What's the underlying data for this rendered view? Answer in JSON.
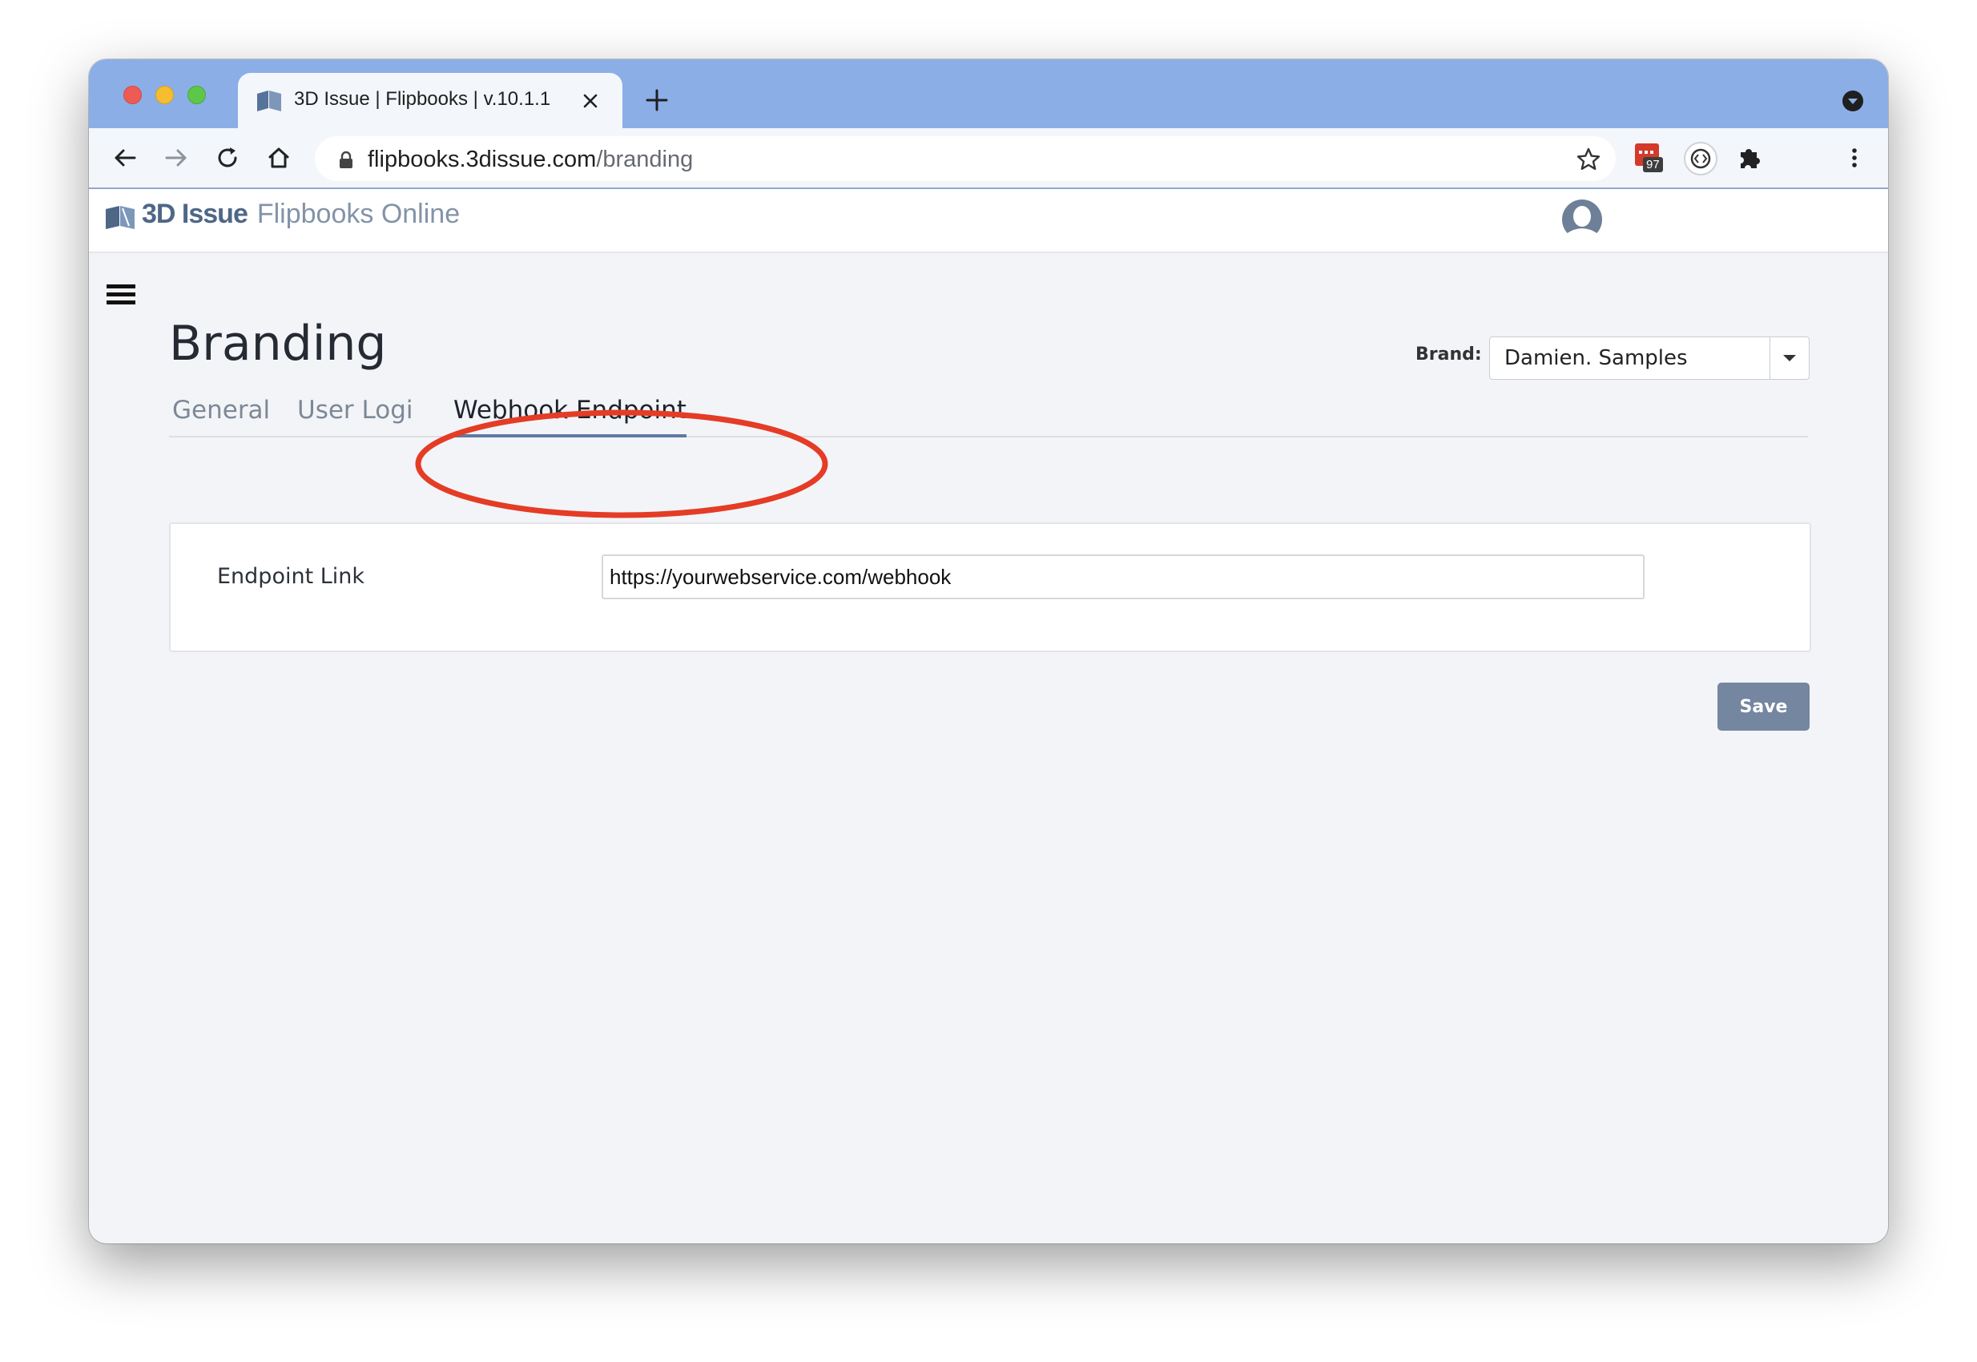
{
  "browser": {
    "tab_title": "3D Issue | Flipbooks | v.10.1.1",
    "url_host": "flipbooks.3dissue.com",
    "url_path": "/branding",
    "extension_badge": "97"
  },
  "header": {
    "logo_strong": "3D Issue",
    "logo_light": "Flipbooks Online"
  },
  "page": {
    "title": "Branding",
    "brand_label": "Brand:",
    "brand_value": "Damien. Samples",
    "tabs": [
      {
        "label": "General"
      },
      {
        "label": "User Login"
      },
      {
        "label": "Webhook Endpoint",
        "active": true
      }
    ]
  },
  "form": {
    "endpoint_label": "Endpoint Link",
    "endpoint_value": "https://yourwebservice.com/webhook"
  },
  "actions": {
    "save_label": "Save"
  },
  "colors": {
    "tabstrip": "#8caee6",
    "accent": "#5f7aa2",
    "save_button": "#7486a0",
    "annotation": "#e43c25"
  }
}
